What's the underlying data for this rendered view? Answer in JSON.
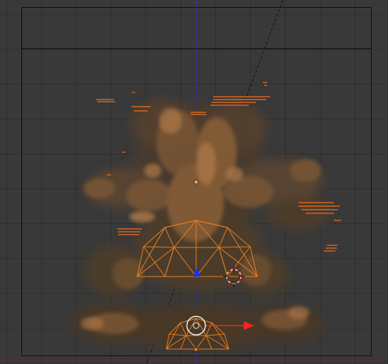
{
  "viewport": {
    "view": "camera",
    "colors": {
      "background": "#393939",
      "grid": "#2f2f2f",
      "frame": "#0e0e0e",
      "smoke_dark": "#4a3a2e",
      "smoke_mid": "#7a5634",
      "smoke_light": "#b07a48",
      "fire": "#e86a1c",
      "selection": "#e87d1e",
      "axis_z": "#2a2ad0",
      "axis_x": "#c02020",
      "arrow_z": "#1830ff",
      "arrow_x": "#ff2020",
      "white": "#f0f0f0"
    },
    "objects": [
      {
        "name": "smoke-domain",
        "type": "smoke simulation",
        "selected": false
      },
      {
        "name": "emitter-icosphere-large",
        "type": "icosphere wireframe",
        "selected": true
      },
      {
        "name": "emitter-icosphere-small",
        "type": "icosphere wireframe",
        "selected": true
      },
      {
        "name": "3d-cursor",
        "icon": "crosshair-icon"
      },
      {
        "name": "transform-gizmo",
        "icon": "arrows-icon"
      }
    ]
  }
}
